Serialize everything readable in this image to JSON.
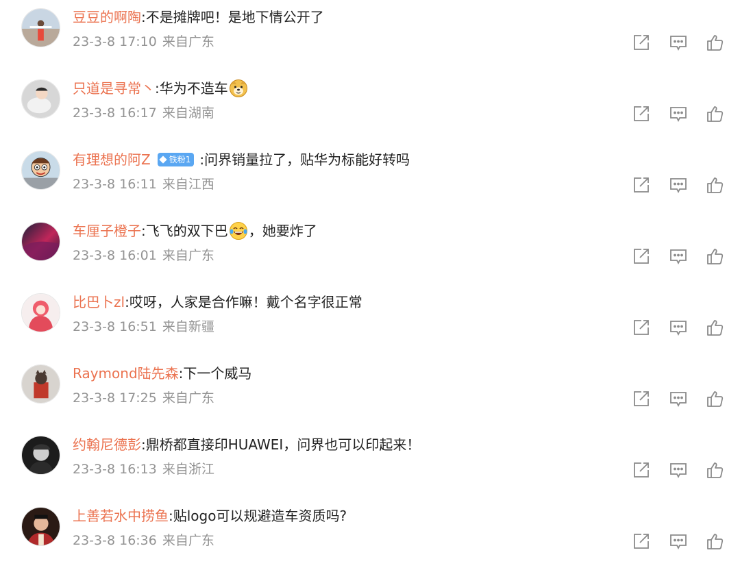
{
  "comments": [
    {
      "user": "豆豆的啊陶",
      "text": "不是摊牌吧！是地下情公开了",
      "time": "23-3-8 17:10",
      "location": "来自广东"
    },
    {
      "user": "只道是寻常丶",
      "text": "华为不造车",
      "time": "23-3-8 16:17",
      "location": "来自湖南",
      "emoji": "doge-emoji-icon"
    },
    {
      "user": "有理想的阿Z",
      "badge": "铁粉1",
      "text": "问界销量拉了，贴华为标能好转吗",
      "time": "23-3-8 16:11",
      "location": "来自江西"
    },
    {
      "user": "车厘子橙子",
      "text_before": "飞飞的双下巴",
      "text_after": "，她要炸了",
      "time": "23-3-8 16:01",
      "location": "来自广东",
      "emoji": "laugh-cry-emoji-icon"
    },
    {
      "user": "比巴卜zl",
      "text": "哎呀，人家是合作嘛！戴个名字很正常",
      "time": "23-3-8 16:51",
      "location": "来自新疆"
    },
    {
      "user": "Raymond陆先森",
      "text": "下一个威马",
      "time": "23-3-8 17:25",
      "location": "来自广东"
    },
    {
      "user": "约翰尼德彭",
      "text": "鼎桥都直接印HUAWEI，问界也可以印起来！",
      "time": "23-3-8 16:13",
      "location": "来自浙江"
    },
    {
      "user": "上善若水中捞鱼",
      "text": "贴logo可以规避造车资质吗?",
      "time": "23-3-8 16:36",
      "location": "来自广东"
    }
  ],
  "colors": {
    "username": "#eb7350",
    "text": "#222222",
    "meta": "#939393",
    "icon": "#8a8a8a",
    "badge": "#5aa7f2"
  },
  "icons": {
    "share": "share-icon",
    "reply": "comment-icon",
    "like": "thumbs-up-icon"
  }
}
